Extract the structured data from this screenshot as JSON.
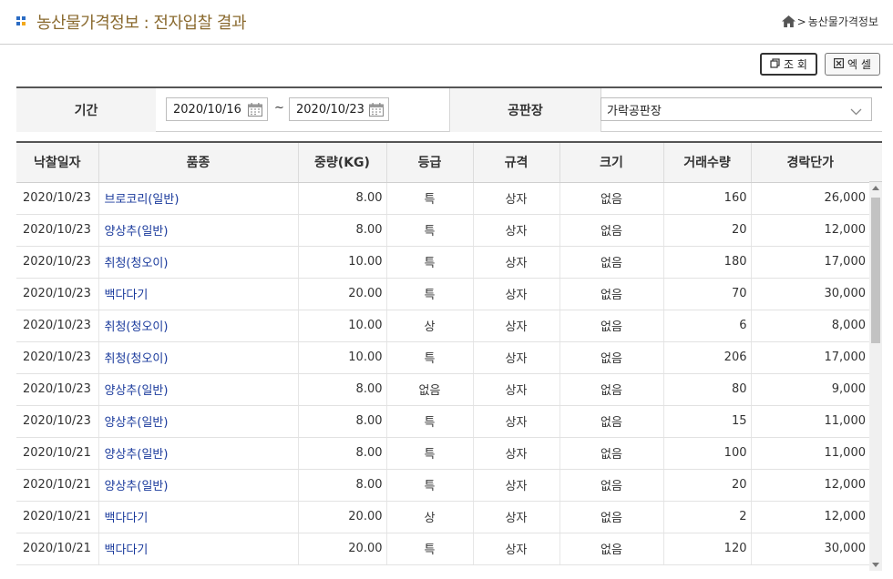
{
  "header": {
    "title": "농산물가격정보 : 전자입찰 결과",
    "breadcrumb": [
      ">",
      "농산물가격정보"
    ]
  },
  "toolbar": {
    "search_label": "조 회",
    "excel_label": "엑 셀"
  },
  "filter": {
    "period_label": "기간",
    "date_from": "2020/10/16",
    "separator": "~",
    "date_to": "2020/10/23",
    "market_label": "공판장",
    "market_value": "가락공판장"
  },
  "table": {
    "columns": [
      "낙찰일자",
      "품종",
      "중량(KG)",
      "등급",
      "규격",
      "크기",
      "거래수량",
      "경락단가"
    ],
    "rows": [
      [
        "2020/10/23",
        "브로코리(일반)",
        "8.00",
        "특",
        "상자",
        "없음",
        "160",
        "26,000"
      ],
      [
        "2020/10/23",
        "양상추(일반)",
        "8.00",
        "특",
        "상자",
        "없음",
        "20",
        "12,000"
      ],
      [
        "2020/10/23",
        "취청(청오이)",
        "10.00",
        "특",
        "상자",
        "없음",
        "180",
        "17,000"
      ],
      [
        "2020/10/23",
        "백다다기",
        "20.00",
        "특",
        "상자",
        "없음",
        "70",
        "30,000"
      ],
      [
        "2020/10/23",
        "취청(청오이)",
        "10.00",
        "상",
        "상자",
        "없음",
        "6",
        "8,000"
      ],
      [
        "2020/10/23",
        "취청(청오이)",
        "10.00",
        "특",
        "상자",
        "없음",
        "206",
        "17,000"
      ],
      [
        "2020/10/23",
        "양상추(일반)",
        "8.00",
        "없음",
        "상자",
        "없음",
        "80",
        "9,000"
      ],
      [
        "2020/10/23",
        "양상추(일반)",
        "8.00",
        "특",
        "상자",
        "없음",
        "15",
        "11,000"
      ],
      [
        "2020/10/21",
        "양상추(일반)",
        "8.00",
        "특",
        "상자",
        "없음",
        "100",
        "11,000"
      ],
      [
        "2020/10/21",
        "양상추(일반)",
        "8.00",
        "특",
        "상자",
        "없음",
        "20",
        "12,000"
      ],
      [
        "2020/10/21",
        "백다다기",
        "20.00",
        "상",
        "상자",
        "없음",
        "2",
        "12,000"
      ],
      [
        "2020/10/21",
        "백다다기",
        "20.00",
        "특",
        "상자",
        "없음",
        "120",
        "30,000"
      ]
    ]
  },
  "icons": {
    "home": "home-icon",
    "search": "search-icon",
    "excel": "excel-icon",
    "calendar": "calendar-icon",
    "dropdown": "chevron-down-icon"
  },
  "colors": {
    "title": "#8a6a2f",
    "link": "#1a3a9c",
    "header_bg": "#f4f4f4"
  }
}
